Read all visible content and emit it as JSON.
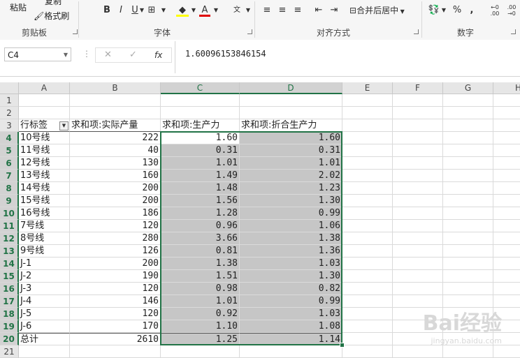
{
  "ribbon": {
    "clipboard": {
      "paste": "粘贴",
      "copy": "复制",
      "format_painter": "格式刷",
      "group_name": "剪贴板"
    },
    "font": {
      "group_name": "字体",
      "bold": "B",
      "italic": "I",
      "underline": "U"
    },
    "alignment": {
      "group_name": "对齐方式",
      "merge_center": "合并后居中"
    },
    "number": {
      "group_name": "数字",
      "percent": "%",
      "comma": ","
    }
  },
  "formula_bar": {
    "name_box": "C4",
    "cancel": "✕",
    "enter": "✓",
    "fx": "fx",
    "value": "1.60096153846154"
  },
  "columns": [
    "A",
    "B",
    "C",
    "D",
    "E",
    "F",
    "G",
    "H"
  ],
  "rows": [
    "1",
    "2",
    "3",
    "4",
    "5",
    "6",
    "7",
    "8",
    "9",
    "10",
    "11",
    "12",
    "13",
    "14",
    "15",
    "16",
    "17",
    "18",
    "19",
    "20",
    "21"
  ],
  "table": {
    "headers": [
      "行标签",
      "求和项:实际产量",
      "求和项:生产力",
      "求和项:折合生产力"
    ],
    "data": [
      [
        "10号线",
        "222",
        "1.60",
        "1.60"
      ],
      [
        "11号线",
        "40",
        "0.31",
        "0.31"
      ],
      [
        "12号线",
        "130",
        "1.01",
        "1.01"
      ],
      [
        "13号线",
        "160",
        "1.49",
        "2.02"
      ],
      [
        "14号线",
        "200",
        "1.48",
        "1.23"
      ],
      [
        "15号线",
        "200",
        "1.56",
        "1.30"
      ],
      [
        "16号线",
        "186",
        "1.28",
        "0.99"
      ],
      [
        "7号线",
        "120",
        "0.96",
        "1.06"
      ],
      [
        "8号线",
        "280",
        "3.66",
        "1.38"
      ],
      [
        "9号线",
        "126",
        "0.81",
        "1.36"
      ],
      [
        "J-1",
        "200",
        "1.38",
        "1.03"
      ],
      [
        "J-2",
        "190",
        "1.51",
        "1.30"
      ],
      [
        "J-3",
        "120",
        "0.98",
        "0.82"
      ],
      [
        "J-4",
        "146",
        "1.01",
        "0.99"
      ],
      [
        "J-5",
        "120",
        "0.92",
        "1.03"
      ],
      [
        "J-6",
        "170",
        "1.10",
        "1.08"
      ],
      [
        "总计",
        "2610",
        "1.25",
        "1.14"
      ]
    ]
  },
  "watermark": {
    "brand": "Bai经验",
    "url": "jingyan.baidu.com"
  }
}
